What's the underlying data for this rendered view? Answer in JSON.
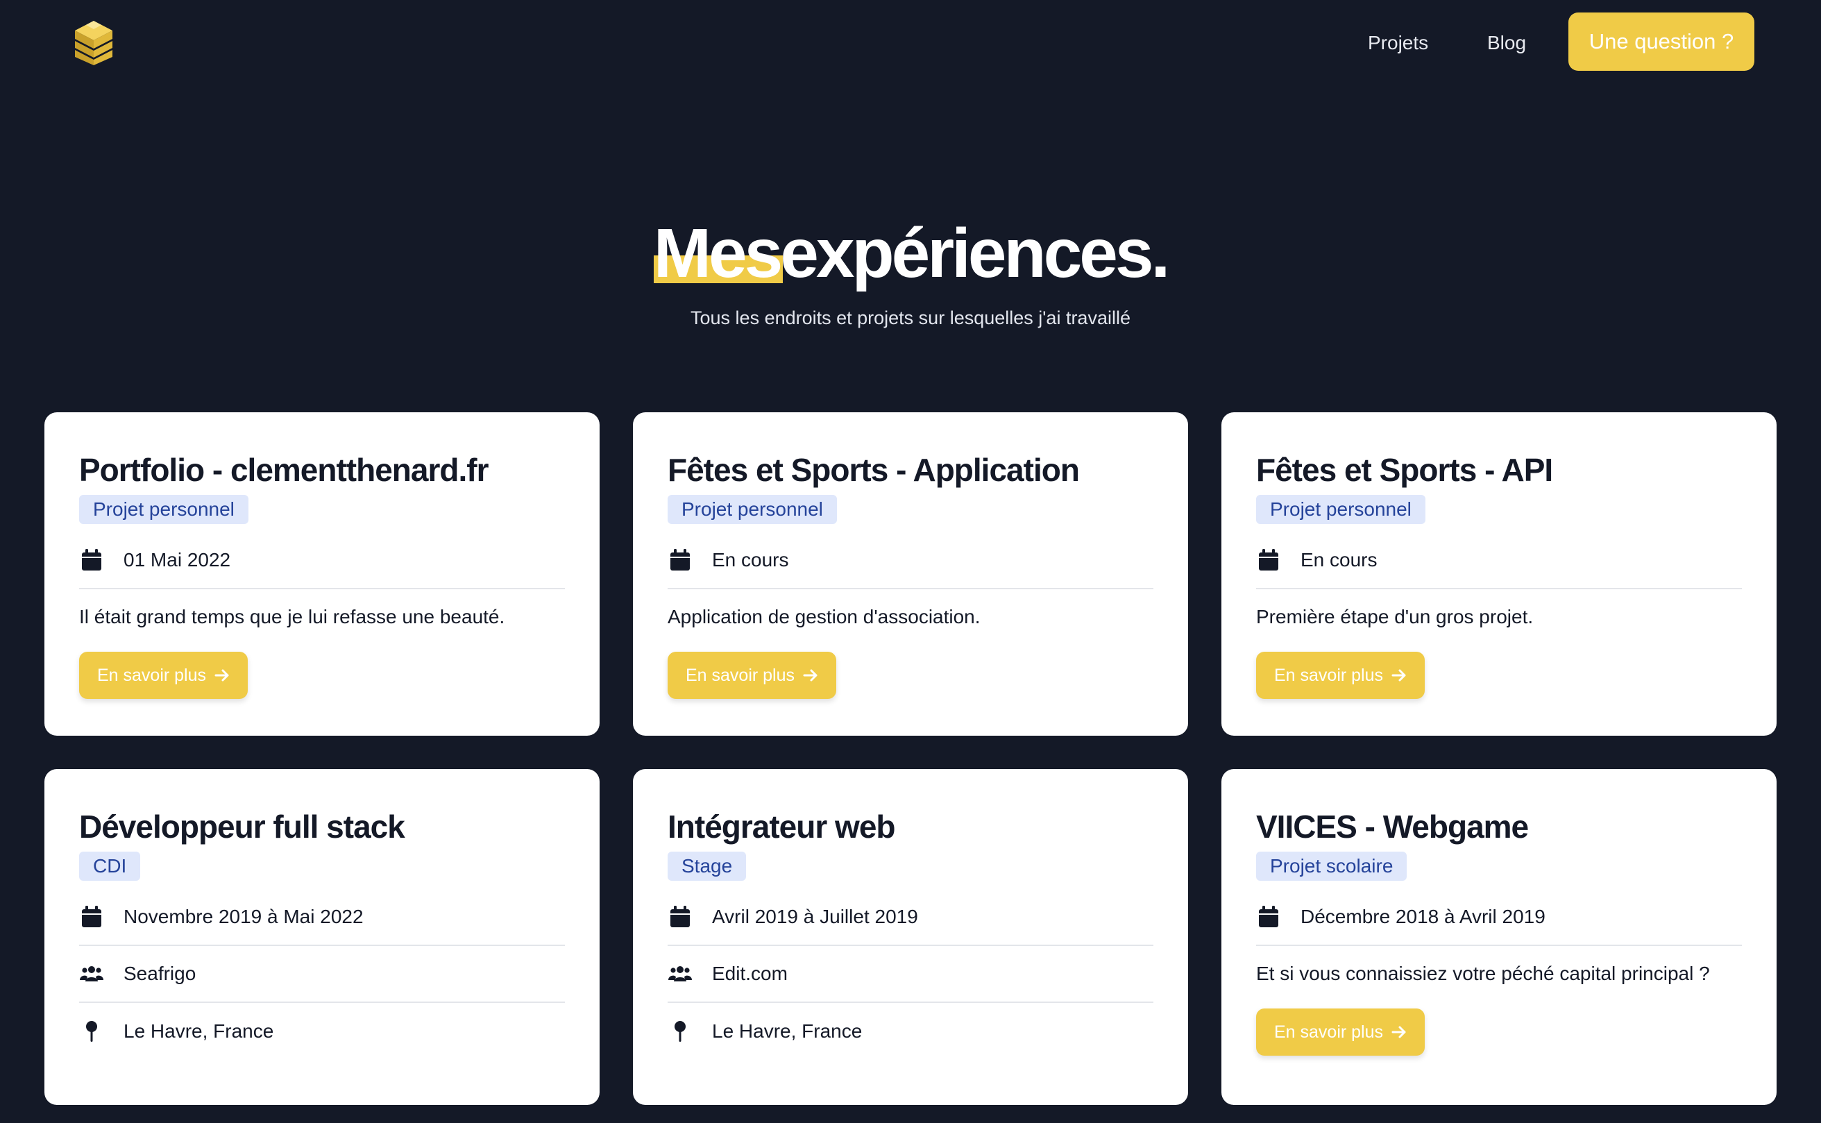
{
  "nav": {
    "logo": "cube-logo",
    "links": [
      "Projets",
      "Blog"
    ],
    "cta": "Une question ?"
  },
  "hero": {
    "title_highlight": "Mes",
    "title_rest": "expériences.",
    "subtitle": "Tous les endroits et projets sur lesquelles j'ai travaillé"
  },
  "cards": [
    {
      "title": "Portfolio - clementthenard.fr",
      "tag": "Projet personnel",
      "date": "01 Mai 2022",
      "description": "Il était grand temps que je lui refasse une beauté.",
      "button": "En savoir plus"
    },
    {
      "title": "Fêtes et Sports - Application",
      "tag": "Projet personnel",
      "date": "En cours",
      "description": "Application de gestion d'association.",
      "button": "En savoir plus"
    },
    {
      "title": "Fêtes et Sports - API",
      "tag": "Projet personnel",
      "date": "En cours",
      "description": "Première étape d'un gros projet.",
      "button": "En savoir plus"
    },
    {
      "title": "Développeur full stack",
      "tag": "CDI",
      "date": "Novembre 2019 à Mai 2022",
      "company": "Seafrigo",
      "location": "Le Havre, France"
    },
    {
      "title": "Intégrateur web",
      "tag": "Stage",
      "date": "Avril 2019 à Juillet 2019",
      "company": "Edit.com",
      "location": "Le Havre, France"
    },
    {
      "title": "VIICES - Webgame",
      "tag": "Projet scolaire",
      "date": "Décembre 2018 à Avril 2019",
      "description": "Et si vous connaissiez votre péché capital principal ?",
      "button": "En savoir plus"
    }
  ],
  "colors": {
    "background": "#141927",
    "accent": "#f0cb47",
    "tag_bg": "#dfe7fb",
    "tag_text": "#25439a"
  },
  "icons": {
    "date": "calendar-icon",
    "company": "users-icon",
    "location": "map-pin-icon",
    "button": "arrow-right-icon"
  }
}
